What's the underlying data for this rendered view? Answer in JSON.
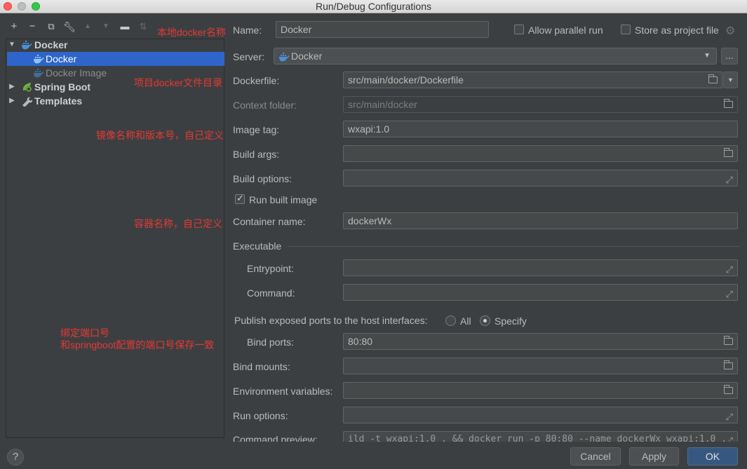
{
  "window": {
    "title": "Run/Debug Configurations"
  },
  "toolbar": {
    "add_icon": "plus-icon",
    "remove_icon": "minus-icon",
    "copy_icon": "copy-icon",
    "edit_icon": "wrench-icon",
    "up_icon": "arrow-up-icon",
    "down_icon": "arrow-down-icon",
    "folder_icon": "new-folder-icon",
    "sort_icon": "sort-icon"
  },
  "tree": {
    "docker_group": "Docker",
    "docker_item": "Docker",
    "docker_image_item": "Docker Image",
    "spring_boot": "Spring Boot",
    "templates": "Templates"
  },
  "annotations": {
    "name_note": "本地docker名称",
    "dockerfile_note": "项目docker文件目录",
    "image_note": "镜像名称和版本号，自己定义",
    "container_note": "容器名称，自己定义",
    "ports_note_1": "绑定端口号",
    "ports_note_2": "和springboot配置的端口号保存一致"
  },
  "form": {
    "name_label": "Name:",
    "name_value": "Docker",
    "allow_parallel_label": "Allow parallel run",
    "allow_parallel_checked": false,
    "store_project_label": "Store as project file",
    "store_project_checked": false,
    "server_label": "Server:",
    "server_value": "Docker",
    "server_more": "...",
    "dockerfile_label": "Dockerfile:",
    "dockerfile_value": "src/main/docker/Dockerfile",
    "context_label": "Context folder:",
    "context_value": "src/main/docker",
    "image_tag_label": "Image tag:",
    "image_tag_value": "wxapi:1.0",
    "build_args_label": "Build args:",
    "build_args_value": "",
    "build_options_label": "Build options:",
    "build_options_value": "",
    "run_built_label": "Run built image",
    "run_built_checked": true,
    "container_label": "Container name:",
    "container_value": "dockerWx",
    "executable_label": "Executable",
    "entrypoint_label": "Entrypoint:",
    "entrypoint_value": "",
    "command_label": "Command:",
    "command_value": "",
    "publish_label": "Publish exposed ports to the host interfaces:",
    "publish_all_label": "All",
    "publish_specify_label": "Specify",
    "publish_selected": "Specify",
    "bind_ports_label": "Bind ports:",
    "bind_ports_value": "80:80",
    "bind_mounts_label": "Bind mounts:",
    "bind_mounts_value": "",
    "env_label": "Environment variables:",
    "env_value": "",
    "run_options_label": "Run options:",
    "run_options_value": "",
    "preview_label": "Command preview:",
    "preview_value": "ild -t wxapi:1.0 . && docker run -p 80:80 --name dockerWx wxapi:1.0 ."
  },
  "buttons": {
    "help": "?",
    "cancel": "Cancel",
    "apply": "Apply",
    "ok": "OK"
  },
  "colors": {
    "background": "#3c3f41",
    "selection": "#2f65ca",
    "annotation": "#e53935",
    "primary_button": "#365880"
  }
}
